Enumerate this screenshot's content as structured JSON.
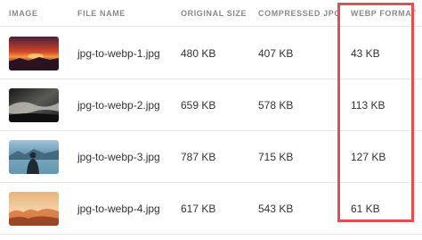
{
  "table": {
    "headers": {
      "image": "IMAGE",
      "file_name": "FILE NAME",
      "original_size": "ORIGINAL SIZE",
      "compressed_jpg": "COMPRESSED JPG",
      "webp_format": "WEBP FORMAT"
    },
    "rows": [
      {
        "file_name": "jpg-to-webp-1.jpg",
        "original_size": "480 KB",
        "compressed_jpg": "407 KB",
        "webp_format": "43 KB"
      },
      {
        "file_name": "jpg-to-webp-2.jpg",
        "original_size": "659 KB",
        "compressed_jpg": "578 KB",
        "webp_format": "113 KB"
      },
      {
        "file_name": "jpg-to-webp-3.jpg",
        "original_size": "787 KB",
        "compressed_jpg": "715 KB",
        "webp_format": "127 KB"
      },
      {
        "file_name": "jpg-to-webp-4.jpg",
        "original_size": "617 KB",
        "compressed_jpg": "543 KB",
        "webp_format": "61 KB"
      }
    ]
  },
  "colors": {
    "highlight": "#e05050",
    "header_text": "#8a8a8a",
    "row_border": "#e6e6e6"
  }
}
